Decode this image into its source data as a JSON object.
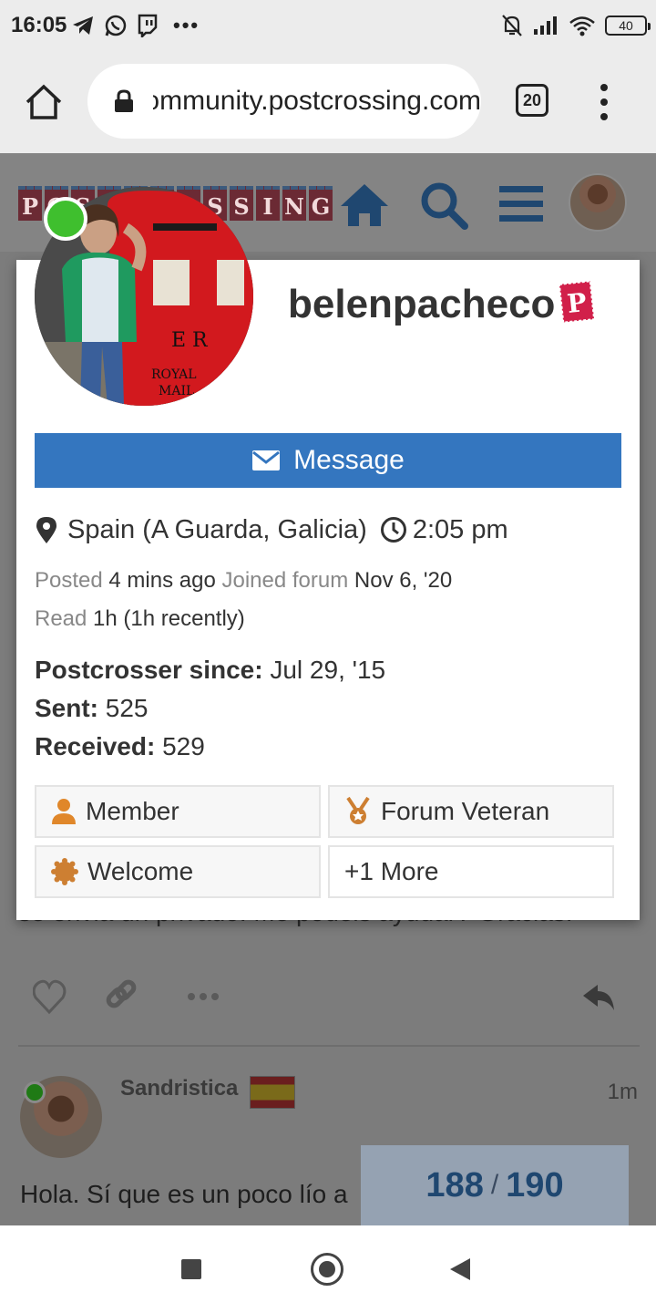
{
  "status_bar": {
    "time": "16:05",
    "left_icons": [
      "telegram-icon",
      "whatsapp-icon",
      "twitch-icon"
    ],
    "more": "•••",
    "right_icons": [
      "mute-icon",
      "signal-icon",
      "wifi-icon"
    ],
    "battery": "40"
  },
  "browser": {
    "url": "community.postcrossing.com",
    "tab_count": "20"
  },
  "site_header": {
    "logo": [
      "P",
      "O",
      "S",
      "T",
      "C",
      "R",
      "O",
      "S",
      "S",
      "I",
      "N",
      "G"
    ],
    "icons": [
      "home-icon",
      "search-icon",
      "hamburger-icon"
    ]
  },
  "user_card": {
    "username": "belenpacheco",
    "message_button": "Message",
    "location": "Spain (A Guarda, Galicia)",
    "local_time": "2:05 pm",
    "posted_label": "Posted",
    "posted_value": "4 mins ago",
    "joined_label": "Joined forum",
    "joined_value": "Nov 6, '20",
    "read_label": "Read",
    "read_value": "1h (1h recently)",
    "postcrosser_label": "Postcrosser since:",
    "postcrosser_value": "Jul 29, '15",
    "sent_label": "Sent:",
    "sent_value": "525",
    "received_label": "Received:",
    "received_value": "529",
    "badges": [
      "Member",
      "Forum Veteran",
      "Welcome",
      "+1 More"
    ]
  },
  "background_post": {
    "cut_text": "se envia un privado. Me podeis ayudar? Gracias.",
    "username": "Sandristica",
    "time": "1m",
    "body": "Hola. Sí que es un poco lío a",
    "progress_current": "188",
    "progress_sep": "/",
    "progress_total": "190"
  },
  "colors": {
    "accent": "#3476bf",
    "online": "#3fbf2e",
    "badge_bronze": "#cd7f32"
  }
}
